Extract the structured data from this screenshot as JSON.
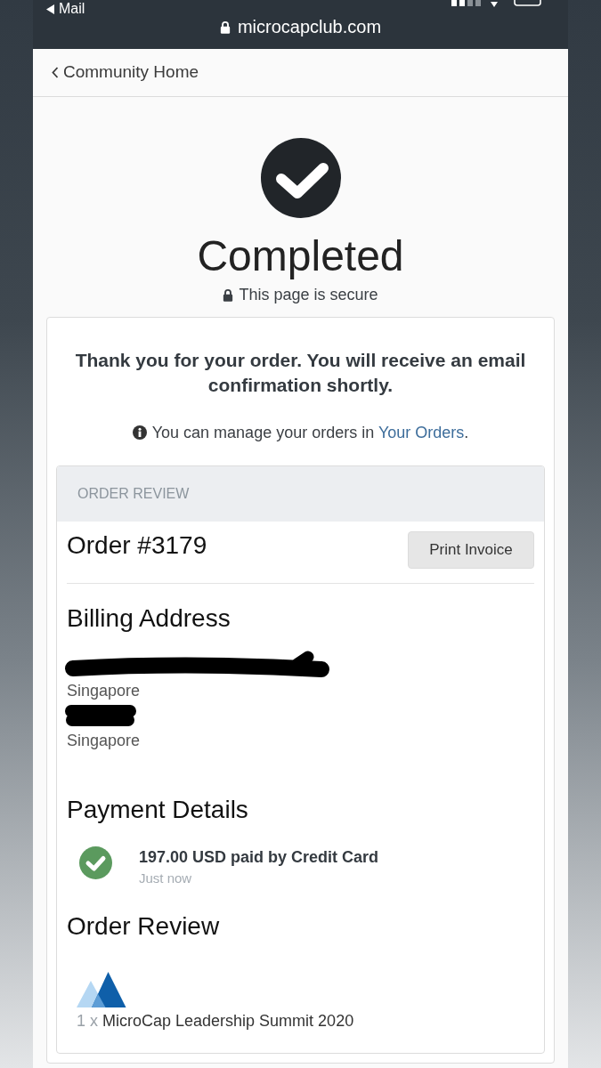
{
  "status_bar": {
    "back_label": "Mail"
  },
  "address_bar": {
    "url": "microcapclub.com"
  },
  "nav": {
    "back_link": "Community Home"
  },
  "hero": {
    "title": "Completed",
    "secure_note": "This page is secure"
  },
  "confirmation": {
    "message": "Thank you for your order. You will receive an email confirmation shortly.",
    "info": {
      "text": "You can manage your orders in ",
      "link": "Your Orders",
      "text_end": "."
    }
  },
  "order_panel": {
    "header": "ORDER REVIEW",
    "order_number": "Order #3179",
    "print_button": "Print Invoice",
    "billing": {
      "heading": "Billing Address",
      "lines": [
        {
          "kind": "redacted-long"
        },
        {
          "kind": "text",
          "text": "Singapore"
        },
        {
          "kind": "redacted-short"
        },
        {
          "kind": "text",
          "text": "Singapore"
        }
      ]
    },
    "payment": {
      "heading": "Payment Details",
      "entries": [
        {
          "summary": "197.00 USD paid by Credit Card",
          "time": "Just now"
        }
      ]
    },
    "review": {
      "heading": "Order Review",
      "items": [
        {
          "quantity": "1 x",
          "name": "MicroCap Leadership Summit 2020"
        }
      ]
    }
  }
}
